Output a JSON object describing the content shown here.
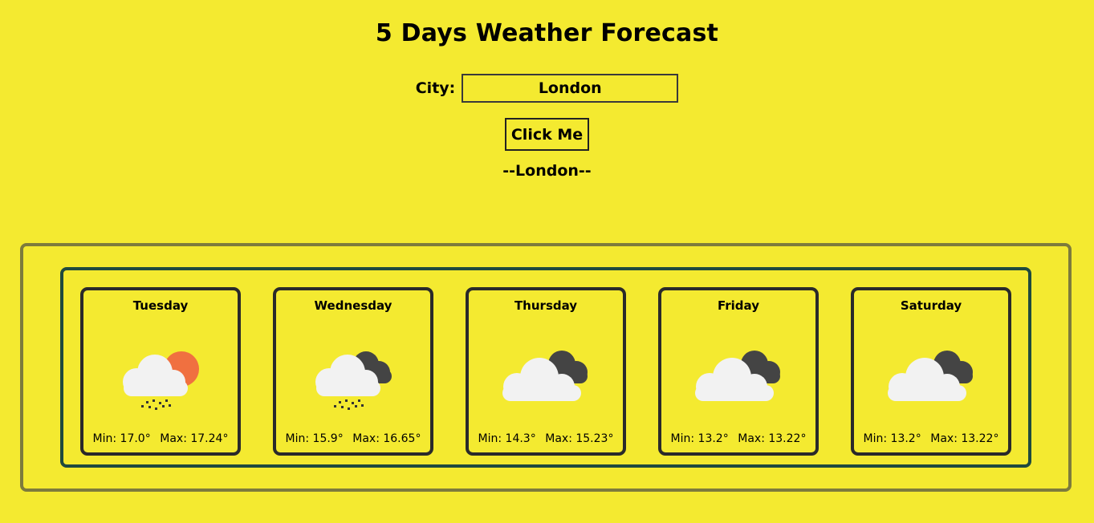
{
  "header": {
    "title": "5 Days Weather Forecast"
  },
  "search": {
    "label": "City:",
    "value": "London",
    "button_label": "Click Me"
  },
  "result": {
    "city_heading": "--London--"
  },
  "colors": {
    "background": "#f4ea30",
    "outer_border": "#7d7b3c",
    "inner_border": "#1f4a3e",
    "card_border": "#2a2a2a",
    "sun": "#f07040",
    "dark_cloud": "#444444",
    "light_cloud": "#f2f2f2"
  },
  "forecast": [
    {
      "day": "Tuesday",
      "icon": "sun-cloud-rain-icon",
      "min": "Min: 17.0°",
      "max": "Max: 17.24°"
    },
    {
      "day": "Wednesday",
      "icon": "dark-cloud-rain-icon",
      "min": "Min: 15.9°",
      "max": "Max: 16.65°"
    },
    {
      "day": "Thursday",
      "icon": "broken-clouds-icon",
      "min": "Min: 14.3°",
      "max": "Max: 15.23°"
    },
    {
      "day": "Friday",
      "icon": "broken-clouds-icon",
      "min": "Min: 13.2°",
      "max": "Max: 13.22°"
    },
    {
      "day": "Saturday",
      "icon": "broken-clouds-icon",
      "min": "Min: 13.2°",
      "max": "Max: 13.22°"
    }
  ]
}
